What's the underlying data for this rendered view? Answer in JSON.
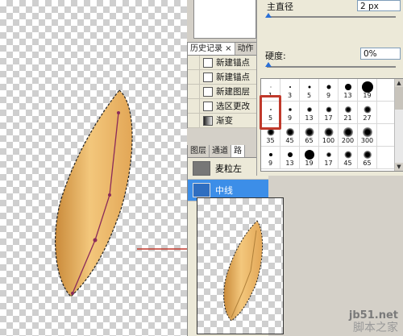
{
  "brush_panel": {
    "diameter_label": "主直径",
    "diameter_value": "2 px",
    "hardness_label": "硬度:",
    "hardness_value": "0%",
    "presets": [
      {
        "label": "1",
        "size": 1,
        "soft": false
      },
      {
        "label": "3",
        "size": 2,
        "soft": false
      },
      {
        "label": "5",
        "size": 3,
        "soft": false
      },
      {
        "label": "9",
        "size": 5,
        "soft": false
      },
      {
        "label": "13",
        "size": 8,
        "soft": false
      },
      {
        "label": "19",
        "size": 14,
        "soft": false
      },
      {
        "label": "",
        "size": 0,
        "soft": false
      },
      {
        "label": "5",
        "size": 2,
        "soft": true
      },
      {
        "label": "9",
        "size": 4,
        "soft": true
      },
      {
        "label": "13",
        "size": 6,
        "soft": true
      },
      {
        "label": "17",
        "size": 7,
        "soft": true
      },
      {
        "label": "21",
        "size": 8,
        "soft": true
      },
      {
        "label": "27",
        "size": 9,
        "soft": true
      },
      {
        "label": "",
        "size": 0,
        "soft": false
      },
      {
        "label": "35",
        "size": 9,
        "soft": true
      },
      {
        "label": "45",
        "size": 10,
        "soft": true
      },
      {
        "label": "65",
        "size": 11,
        "soft": true
      },
      {
        "label": "100",
        "size": 11,
        "soft": true
      },
      {
        "label": "200",
        "size": 12,
        "soft": true
      },
      {
        "label": "300",
        "size": 12,
        "soft": true
      },
      {
        "label": "",
        "size": 0,
        "soft": false
      },
      {
        "label": "9",
        "size": 4,
        "soft": false
      },
      {
        "label": "13",
        "size": 6,
        "soft": false
      },
      {
        "label": "19",
        "size": 12,
        "soft": false
      },
      {
        "label": "17",
        "size": 6,
        "soft": true
      },
      {
        "label": "45",
        "size": 9,
        "soft": true
      },
      {
        "label": "65",
        "size": 10,
        "soft": true
      },
      {
        "label": "",
        "size": 0,
        "soft": false
      }
    ]
  },
  "history_panel": {
    "tabs": [
      "历史记录 ×",
      "动作"
    ],
    "items": [
      "新建锚点",
      "新建锚点",
      "新建图层",
      "选区更改",
      "渐变"
    ]
  },
  "layers_panel": {
    "tabs": [
      "图层",
      "通道",
      "路"
    ],
    "layers": [
      {
        "name": "麦粒左",
        "selected": false
      },
      {
        "name": "中线",
        "selected": true
      }
    ]
  },
  "watermark": {
    "site": "jb51.net",
    "brand": "脚本之家"
  },
  "colors": {
    "leaf": "#e8b060",
    "selection_highlight": "#3c8ee8",
    "callout": "#c0392b",
    "path": "#8a2a5a"
  }
}
